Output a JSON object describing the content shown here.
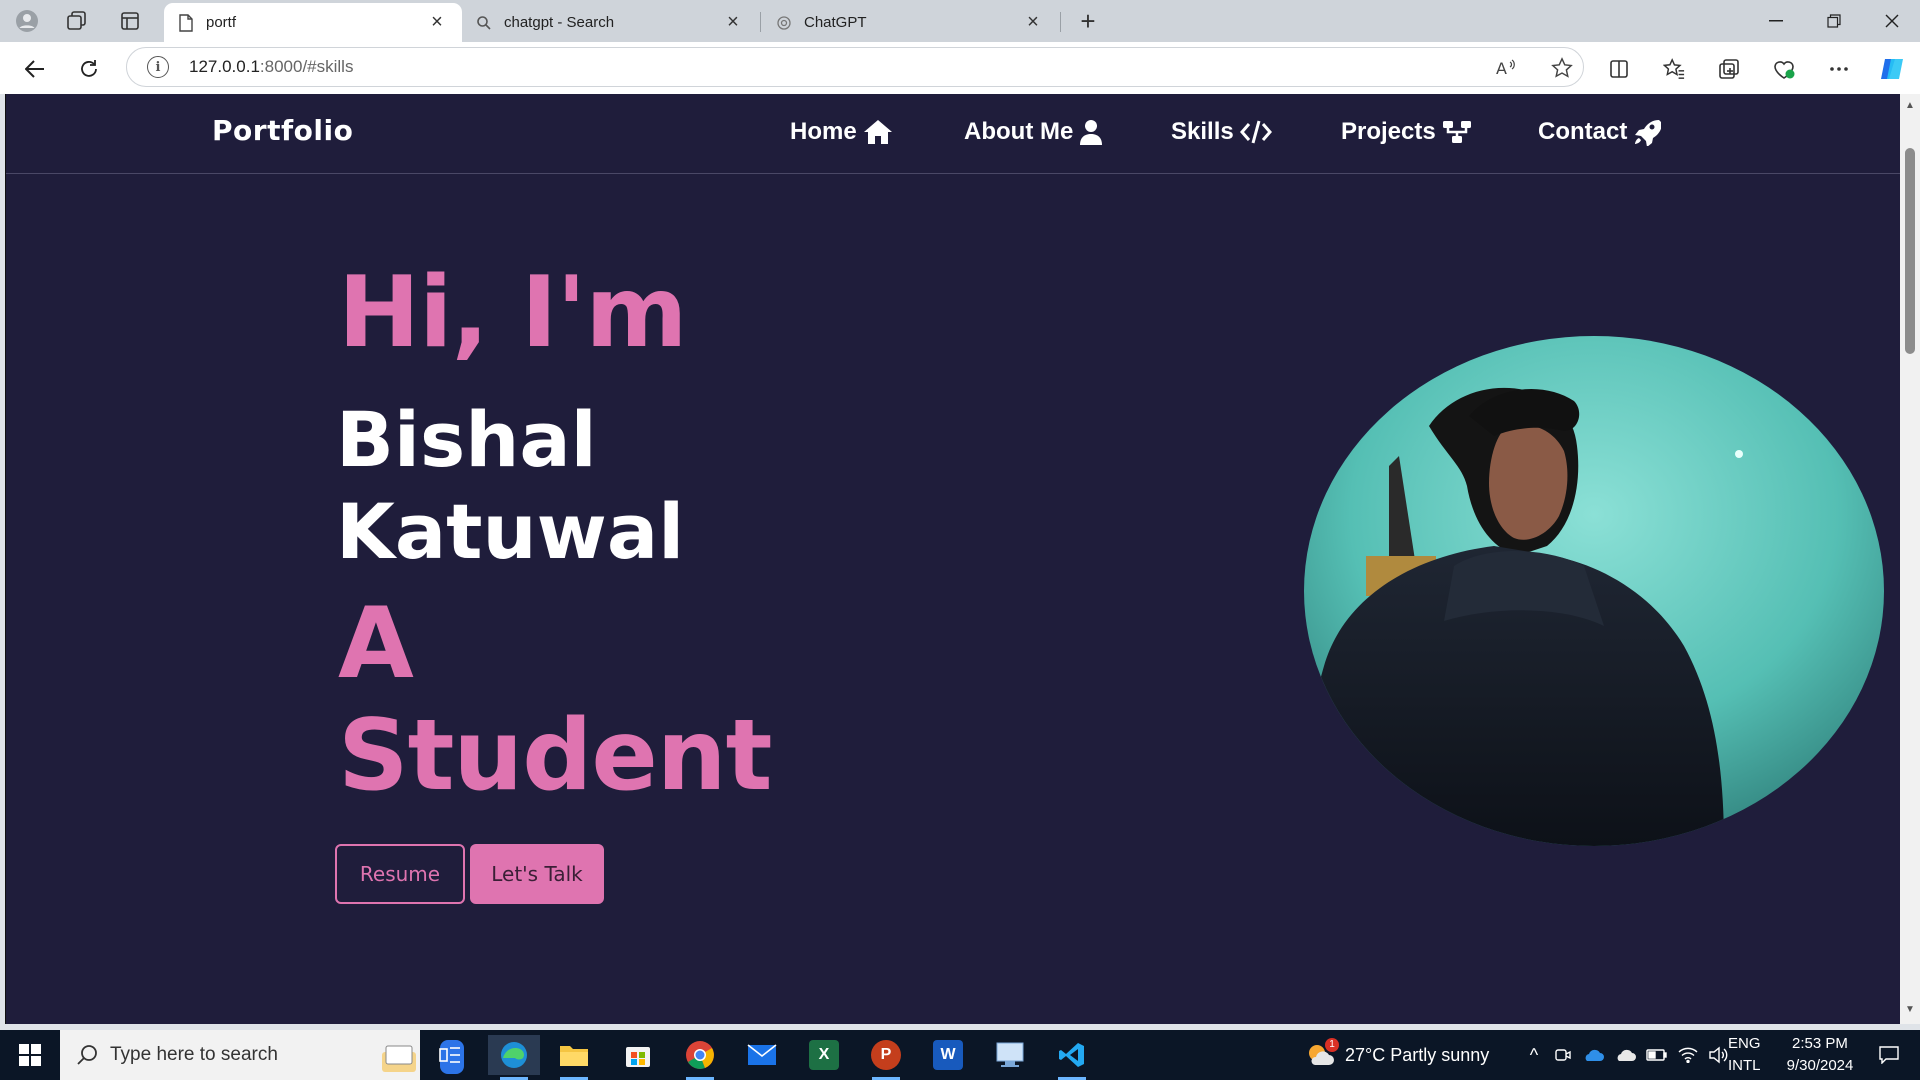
{
  "browser": {
    "tabs": [
      {
        "title": "portf",
        "active": true
      },
      {
        "title": "chatgpt - Search",
        "active": false
      },
      {
        "title": "ChatGPT",
        "active": false
      }
    ],
    "url_host": "127.0.0.1",
    "url_rest": ":8000/#skills"
  },
  "site": {
    "logo": "Portfolio",
    "nav": [
      {
        "label": "Home",
        "icon": "home-icon"
      },
      {
        "label": "About Me",
        "icon": "user-icon"
      },
      {
        "label": "Skills",
        "icon": "code-icon"
      },
      {
        "label": "Projects",
        "icon": "sitemap-icon"
      },
      {
        "label": "Contact",
        "icon": "rocket-icon"
      }
    ],
    "hero": {
      "greeting": "Hi, I'm",
      "name": "Bishal Katuwal",
      "role": "A Student",
      "resume_label": "Resume",
      "talk_label": "Let's Talk"
    },
    "colors": {
      "background": "#1f1d3b",
      "accent": "#df74b0",
      "text": "#ffffff"
    }
  },
  "taskbar": {
    "search_placeholder": "Type here to search",
    "weather": "27°C  Partly sunny",
    "language_top": "ENG",
    "language_bottom": "INTL",
    "time": "2:53 PM",
    "date": "9/30/2024",
    "weather_badge": "1"
  }
}
